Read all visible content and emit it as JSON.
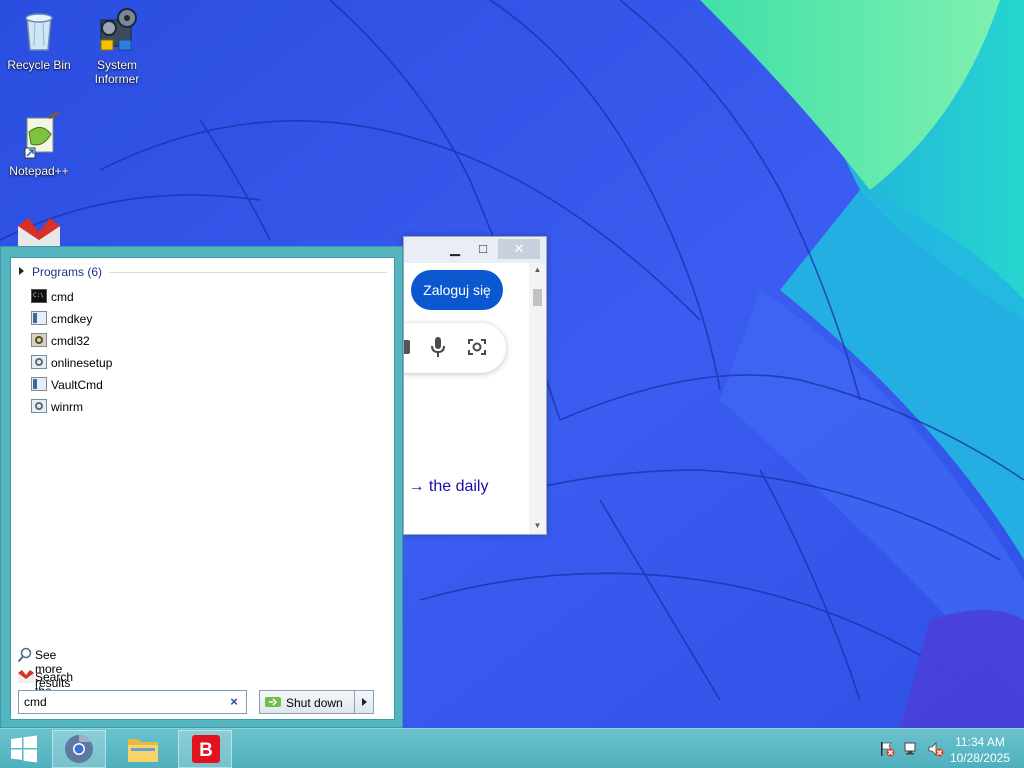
{
  "desktop": {
    "icons": [
      {
        "label": "Recycle Bin"
      },
      {
        "label": "System Informer"
      },
      {
        "label": "Notepad++"
      }
    ]
  },
  "browser": {
    "login_label": "Zaloguj się",
    "daily_text": "s → the daily",
    "minimize": "▁",
    "maximize": "□",
    "close": "✕"
  },
  "start_menu": {
    "programs_header": "Programs (6)",
    "programs": [
      {
        "label": "cmd",
        "icon": "console-icon"
      },
      {
        "label": "cmdkey",
        "icon": "app-window-icon"
      },
      {
        "label": "cmdl32",
        "icon": "network-app-icon"
      },
      {
        "label": "onlinesetup",
        "icon": "settings-app-icon"
      },
      {
        "label": "VaultCmd",
        "icon": "app-window-icon"
      },
      {
        "label": "winrm",
        "icon": "settings-app-icon"
      }
    ],
    "see_more": "See more results",
    "search_internet": "Search the Internet",
    "search_value": "cmd",
    "clear_symbol": "×",
    "shutdown_label": "Shut down"
  },
  "taskbar": {
    "time": "11:34 AM",
    "date": "10/28/2025"
  },
  "colors": {
    "start_menu_frame": "#54b4c0",
    "taskbar": "#5cb8c4",
    "link": "#1e3287",
    "login_button": "#0b57d0"
  }
}
